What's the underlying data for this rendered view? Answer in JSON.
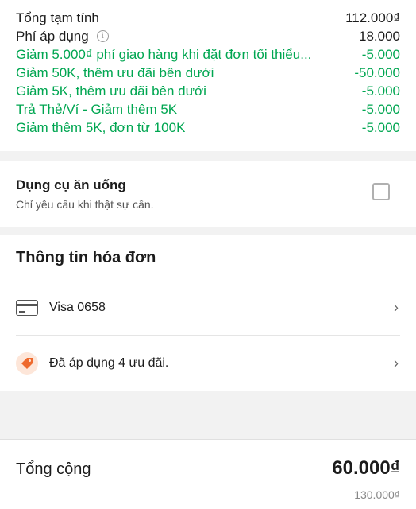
{
  "summary": {
    "subtotal_label": "Tổng tạm tính",
    "subtotal_value": "112.000₫",
    "fee_label": "Phí áp dụng",
    "fee_value": "18.000",
    "discounts": [
      {
        "label": "Giảm 5.000₫ phí giao hàng khi đặt đơn tối thiểu...",
        "value": "-5.000"
      },
      {
        "label": "Giảm 50K, thêm ưu đãi bên dưới",
        "value": "-50.000"
      },
      {
        "label": "Giảm 5K, thêm ưu đãi bên dưới",
        "value": "-5.000"
      },
      {
        "label": "Trả Thẻ/Ví - Giảm thêm 5K",
        "value": "-5.000"
      },
      {
        "label": "Giảm thêm 5K, đơn từ 100K",
        "value": "-5.000"
      }
    ],
    "discount_color": "#00a651"
  },
  "utensils": {
    "title": "Dụng cụ ăn uống",
    "subtitle": "Chỉ yêu cầu khi thật sự cần.",
    "checked": false
  },
  "invoice": {
    "heading": "Thông tin hóa đơn",
    "payment_icon": "credit-card-icon",
    "payment_label": "Visa 0658",
    "promo_icon": "tag-icon",
    "promo_label": "Đã áp dụng 4 ưu đãi.",
    "promo_color": "#ee6a2e"
  },
  "total": {
    "label": "Tổng cộng",
    "amount": "60.000₫",
    "original_amount": "130.000₫"
  }
}
